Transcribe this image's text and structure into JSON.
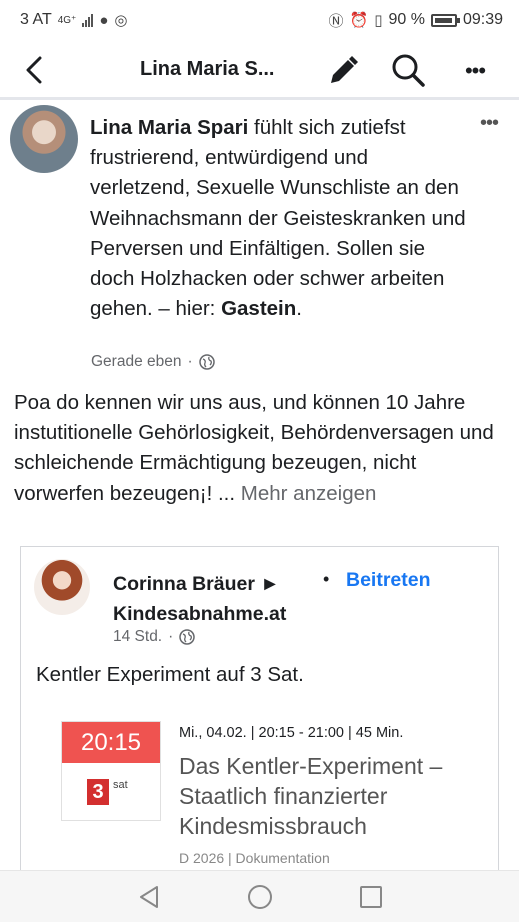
{
  "status_bar": {
    "carrier": "3 AT",
    "network": "4G⁺",
    "battery_percent": "90 %",
    "time": "09:39",
    "icons": [
      "signal-icon",
      "chat-bubble-icon",
      "instagram-icon",
      "nfc-icon",
      "alarm-icon",
      "vibrate-icon",
      "battery-icon"
    ]
  },
  "header": {
    "title": "Lina Maria S...",
    "icons": [
      "back-arrow-icon",
      "pencil-icon",
      "search-icon",
      "more-icon"
    ]
  },
  "post": {
    "author": "Lina Maria Spari",
    "status_text": " fühlt sich zutiefst frustrierend, entwürdigend und verletzend, Sexuelle Wunschliste an den Weihnachsmann der Geisteskranken und Perversen und Einfältigen. Sollen sie doch Holzhacken oder schwer arbeiten gehen. – hier: ",
    "location": "Gastein",
    "location_suffix": ".",
    "timestamp": "Gerade eben",
    "separator": "·",
    "body": "Poa do kennen wir uns aus, und können 10 Jahre instutitionelle Gehörlosigkeit, Behördenversagen und schleichende Ermächtigung bezeugen, nicht vorwerfen bezeugen¡! ...",
    "more_link": "Mehr anzeigen"
  },
  "shared": {
    "author": "Corinna Bräuer ► Kindesabnahme.at",
    "dot": "•",
    "join_label": "Beitreten",
    "timestamp": "14 Std.",
    "separator": "·",
    "text": "Kentler Experiment auf 3 Sat.",
    "program": {
      "time_badge": "20:15",
      "channel_number": "3",
      "channel_suffix": "sat",
      "schedule": "Mi., 04.02. | 20:15 - 21:00 | 45 Min.",
      "title": "Das Kentler-Experiment – Staatlich finanzierter Kindesmissbrauch",
      "meta": "D 2026 | Dokumentation"
    }
  },
  "colors": {
    "link_blue": "#1877f2",
    "time_badge_red": "#ef5350",
    "channel_red": "#d32f2f",
    "muted_gray": "#65676b"
  }
}
